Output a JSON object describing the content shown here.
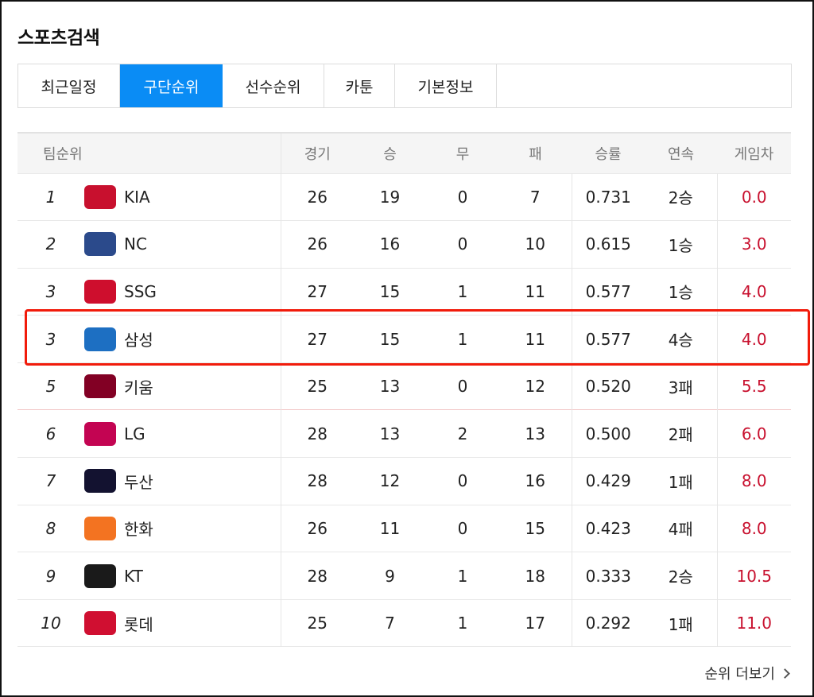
{
  "title": "스포츠검색",
  "tabs": [
    {
      "label": "최근일정",
      "active": false
    },
    {
      "label": "구단순위",
      "active": true
    },
    {
      "label": "선수순위",
      "active": false
    },
    {
      "label": "카툰",
      "active": false
    },
    {
      "label": "기본정보",
      "active": false
    }
  ],
  "columns": [
    "팀순위",
    "경기",
    "승",
    "무",
    "패",
    "승률",
    "연속",
    "게임차"
  ],
  "rows": [
    {
      "rank": "1",
      "team": "KIA",
      "logo": "KIA tigers logo",
      "logo_color": "#c8102e",
      "games": "26",
      "win": "19",
      "draw": "0",
      "loss": "7",
      "pct": "0.731",
      "streak": "2승",
      "gb": "0.0"
    },
    {
      "rank": "2",
      "team": "NC",
      "logo": "NC dinos logo",
      "logo_color": "#2b4a8b",
      "games": "26",
      "win": "16",
      "draw": "0",
      "loss": "10",
      "pct": "0.615",
      "streak": "1승",
      "gb": "3.0"
    },
    {
      "rank": "3",
      "team": "SSG",
      "logo": "SSG landers logo",
      "logo_color": "#ce0e2d",
      "games": "27",
      "win": "15",
      "draw": "1",
      "loss": "11",
      "pct": "0.577",
      "streak": "1승",
      "gb": "4.0"
    },
    {
      "rank": "3",
      "team": "삼성",
      "logo": "Samsung lions logo",
      "logo_color": "#1d6fc2",
      "games": "27",
      "win": "15",
      "draw": "1",
      "loss": "11",
      "pct": "0.577",
      "streak": "4승",
      "gb": "4.0"
    },
    {
      "rank": "5",
      "team": "키움",
      "logo": "Kiwoom heroes logo",
      "logo_color": "#820024",
      "games": "25",
      "win": "13",
      "draw": "0",
      "loss": "12",
      "pct": "0.520",
      "streak": "3패",
      "gb": "5.5"
    },
    {
      "rank": "6",
      "team": "LG",
      "logo": "LG twins logo",
      "logo_color": "#c30452",
      "games": "28",
      "win": "13",
      "draw": "2",
      "loss": "13",
      "pct": "0.500",
      "streak": "2패",
      "gb": "6.0"
    },
    {
      "rank": "7",
      "team": "두산",
      "logo": "Doosan bears logo",
      "logo_color": "#131230",
      "games": "28",
      "win": "12",
      "draw": "0",
      "loss": "16",
      "pct": "0.429",
      "streak": "1패",
      "gb": "8.0"
    },
    {
      "rank": "8",
      "team": "한화",
      "logo": "Hanwha eagles logo",
      "logo_color": "#f37321",
      "games": "26",
      "win": "11",
      "draw": "0",
      "loss": "15",
      "pct": "0.423",
      "streak": "4패",
      "gb": "8.0"
    },
    {
      "rank": "9",
      "team": "KT",
      "logo": "KT wiz logo",
      "logo_color": "#1a1a1a",
      "games": "28",
      "win": "9",
      "draw": "1",
      "loss": "18",
      "pct": "0.333",
      "streak": "2승",
      "gb": "10.5"
    },
    {
      "rank": "10",
      "team": "롯데",
      "logo": "Lotte giants logo",
      "logo_color": "#d00f31",
      "games": "25",
      "win": "7",
      "draw": "1",
      "loss": "17",
      "pct": "0.292",
      "streak": "1패",
      "gb": "11.0"
    }
  ],
  "more_label": "순위 더보기",
  "colors": {
    "accent": "#0a8cf5",
    "gb": "#c8102e",
    "highlight": "#f11b0b"
  }
}
